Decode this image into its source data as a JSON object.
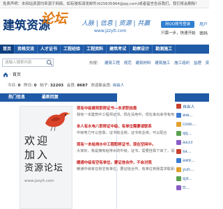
{
  "disclaimer": "免责声明：本网站资源均来源于网络，如有侵权请发邮件(625635964@qq.com)或者留言告诉我们，我们将会删除！",
  "header": {
    "logo_text": "建筑资源",
    "logo_swirl": "论坛",
    "tagline": "人脉 | 信息 | 资源 | 共赢",
    "site_url": "www.jzzylt.com",
    "qq_button": "用QQ账号登录",
    "motto": "只需一步，快速开始",
    "user_cut_1": "用户",
    "user_cut_2": "密码"
  },
  "nav": {
    "items": [
      "首页",
      "资格交流",
      "人才证书",
      "工程经验",
      "工程资料",
      "建筑考试",
      "勘察设计",
      "勘测施工"
    ]
  },
  "search": {
    "placeholder": "请输入搜索内容",
    "hot_label": "热搜：",
    "hot_words": [
      "建筑工程",
      "规范",
      "建筑材料",
      "建筑施工",
      "施工组织",
      "监理",
      "资质",
      "资格",
      "装修"
    ]
  },
  "breadcrumb": {
    "current": "首页"
  },
  "stats": {
    "today_label": "今日:",
    "today_value": "0",
    "yesterday_label": "昨日:",
    "yesterday_value": "0",
    "posts_label": "帖子:",
    "posts_value": "32203",
    "members_label": "会员:",
    "members_value": "8687",
    "newest_label": "欢迎新会员:",
    "newest_value": "自由人"
  },
  "hotinfo": {
    "title_left": "热门信息",
    "title_mid": "最新回复"
  },
  "promo": {
    "line1": "欢迎",
    "line2": "加入",
    "line3": "资源论坛",
    "url": "www.jzzylt.com"
  },
  "posts": [
    {
      "title": "现有中级建筑职称证书—本求职挂靠",
      "body": "我有一本建筑中工程师证书，现在没用中，现在拿出来寻有用"
    },
    {
      "title": "本人有水电八职称证中级，有单位需要请联系",
      "body": "中级电力可以挂靠，证书有业绩，证书有业绩，可以配合"
    },
    {
      "title": "现有一本给排水中工程职称证书，现在空闲中。",
      "body": "大家好，我是拥有给排水的中级，证书，需要挂靠下来了，请来联系"
    },
    {
      "title": "暖通中级有空有单位，要证信合作，不会对我",
      "body": "暖通中级有在有空有单位，要证信合作，有单位到我需求联系我们"
    }
  ],
  "right_panel": {
    "users": [
      "自由人",
      "ww...",
      "cook...",
      "qq...",
      "aa33",
      "sa...",
      "aw9...",
      "yun...",
      "sjd...",
      "tt..."
    ],
    "avatar_colors": [
      "#c7412f",
      "#3b7bd1",
      "#e0a12a",
      "#5aa04e",
      "#8a5cc4",
      "#c7412f",
      "#3b7bd1",
      "#e0a12a",
      "#5aa04e",
      "#8a5cc4"
    ]
  },
  "colors": {
    "nav_blue": "#1f5aa6",
    "logo_blue": "#0d3a7a",
    "accent_orange": "#e07b16",
    "post_red": "#c81a1a"
  }
}
